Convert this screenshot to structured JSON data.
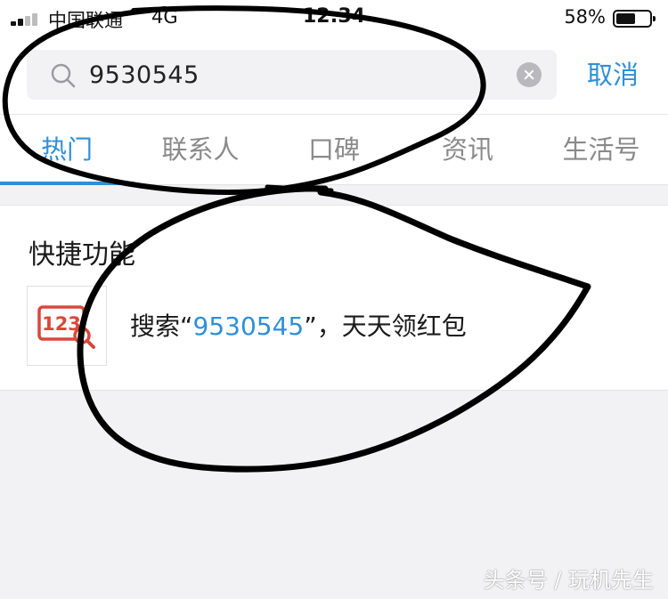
{
  "status_bar": {
    "carrier": "中国联通",
    "network": "4G",
    "time": "12:34",
    "battery_percent": "58%",
    "battery_level": 0.58
  },
  "search": {
    "query": "9530545",
    "cancel_label": "取消"
  },
  "tabs": [
    {
      "label": "热门",
      "active": true
    },
    {
      "label": "联系人",
      "active": false
    },
    {
      "label": "口碑",
      "active": false
    },
    {
      "label": "资讯",
      "active": false
    },
    {
      "label": "生活号",
      "active": false
    }
  ],
  "quick_functions": {
    "title": "快捷功能",
    "items": [
      {
        "icon": "number-search-icon",
        "icon_text": "123",
        "prefix": "搜索“",
        "highlight": "9530545",
        "suffix": "”，天天领红包"
      }
    ]
  },
  "watermark": "头条号 / 玩机先生",
  "colors": {
    "accent": "#2f8fd8",
    "icon_red": "#d9473a",
    "annotation": "#000000"
  }
}
